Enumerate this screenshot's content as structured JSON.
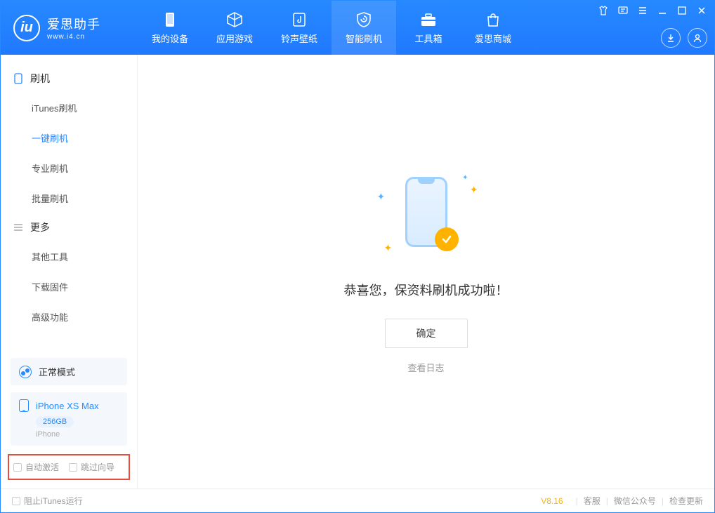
{
  "app": {
    "title": "爱思助手",
    "subtitle": "www.i4.cn"
  },
  "nav": [
    {
      "label": "我的设备"
    },
    {
      "label": "应用游戏"
    },
    {
      "label": "铃声壁纸"
    },
    {
      "label": "智能刷机"
    },
    {
      "label": "工具箱"
    },
    {
      "label": "爱思商城"
    }
  ],
  "sidebar": {
    "group1": {
      "title": "刷机",
      "items": [
        "iTunes刷机",
        "一键刷机",
        "专业刷机",
        "批量刷机"
      ]
    },
    "group2": {
      "title": "更多",
      "items": [
        "其他工具",
        "下载固件",
        "高级功能"
      ]
    }
  },
  "device": {
    "mode": "正常模式",
    "name": "iPhone XS Max",
    "storage": "256GB",
    "type": "iPhone"
  },
  "options": {
    "auto_activate": "自动激活",
    "skip_guide": "跳过向导"
  },
  "main": {
    "success_message": "恭喜您，保资料刷机成功啦！",
    "confirm": "确定",
    "view_log": "查看日志"
  },
  "footer": {
    "block_itunes": "阻止iTunes运行",
    "version": "V8.16",
    "links": [
      "客服",
      "微信公众号",
      "检查更新"
    ]
  }
}
